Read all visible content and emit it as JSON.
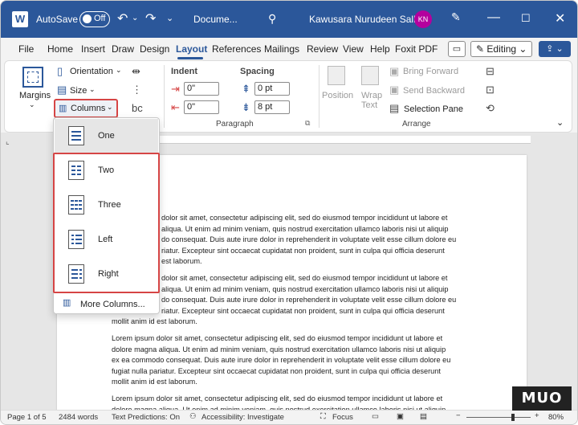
{
  "titlebar": {
    "logo": "W",
    "autosave_label": "AutoSave",
    "autosave_state": "Off",
    "doc_title": "Docume...",
    "user_name": "Kawusara Nurudeen Salley",
    "user_initials": "KN",
    "accent_color": "#2b579a"
  },
  "tabs": [
    "File",
    "Home",
    "Insert",
    "Draw",
    "Design",
    "Layout",
    "References",
    "Mailings",
    "Review",
    "View",
    "Help",
    "Foxit PDF"
  ],
  "active_tab": "Layout",
  "header_actions": {
    "editing_label": "Editing"
  },
  "ribbon": {
    "margins_label": "Margins",
    "orientation_label": "Orientation",
    "size_label": "Size",
    "columns_label": "Columns",
    "indent_label": "Indent",
    "spacing_label": "Spacing",
    "indent_left": "0\"",
    "indent_right": "0\"",
    "spacing_before": "0 pt",
    "spacing_after": "8 pt",
    "paragraph_group": "Paragraph",
    "position_label": "Position",
    "wrap_text_label": "Wrap Text",
    "wrap_label": "Wrap",
    "text_label": "Text",
    "bring_forward_label": "Bring Forward",
    "send_backward_label": "Send Backward",
    "selection_pane_label": "Selection Pane",
    "arrange_group": "Arrange"
  },
  "columns_menu": {
    "items": [
      "One",
      "Two",
      "Three",
      "Left",
      "Right"
    ],
    "selected": "One",
    "more_label": "More Columns..."
  },
  "document": {
    "partial_lines_1": [
      "dolor sit amet, consectetur adipiscing elit, sed do eiusmod tempor incididunt ut labore et",
      "aliqua. Ut enim ad minim veniam, quis nostrud exercitation ullamco laboris nisi ut aliquip",
      "do consequat. Duis aute irure dolor in reprehenderit in voluptate velit esse cillum dolore eu",
      "riatur. Excepteur sint occaecat cupidatat non proident, sunt in culpa qui officia deserunt",
      "est laborum."
    ],
    "partial_lines_2": [
      "dolor sit amet, consectetur adipiscing elit, sed do eiusmod tempor incididunt ut labore et",
      "aliqua. Ut enim ad minim veniam, quis nostrud exercitation ullamco laboris nisi ut aliquip",
      "do consequat. Duis aute irure dolor in reprehenderit in voluptate velit esse cillum dolore eu",
      "riatur. Excepteur sint occaecat cupidatat non proident, sunt in culpa qui officia deserunt"
    ],
    "para2_last": "mollit anim id est laborum.",
    "para3": [
      "Lorem ipsum dolor sit amet, consectetur adipiscing elit, sed do eiusmod tempor incididunt ut labore et",
      "dolore magna aliqua. Ut enim ad minim veniam, quis nostrud exercitation ullamco laboris nisi ut aliquip",
      "ex ea commodo consequat. Duis aute irure dolor in reprehenderit in voluptate velit esse cillum dolore eu",
      "fugiat nulla pariatur. Excepteur sint occaecat cupidatat non proident, sunt in culpa qui officia deserunt",
      "mollit anim id est laborum."
    ],
    "para4": [
      "Lorem ipsum dolor sit amet, consectetur adipiscing elit, sed do eiusmod tempor incididunt ut labore et",
      "dolore magna aliqua. Ut enim ad minim veniam, quis nostrud exercitation ullamco laboris nisi ut aliquip"
    ]
  },
  "statusbar": {
    "page": "Page 1 of 5",
    "words": "2484 words",
    "text_predictions": "Text Predictions: On",
    "accessibility": "Accessibility: Investigate",
    "focus": "Focus",
    "zoom": "80%"
  },
  "watermark": "MUO"
}
